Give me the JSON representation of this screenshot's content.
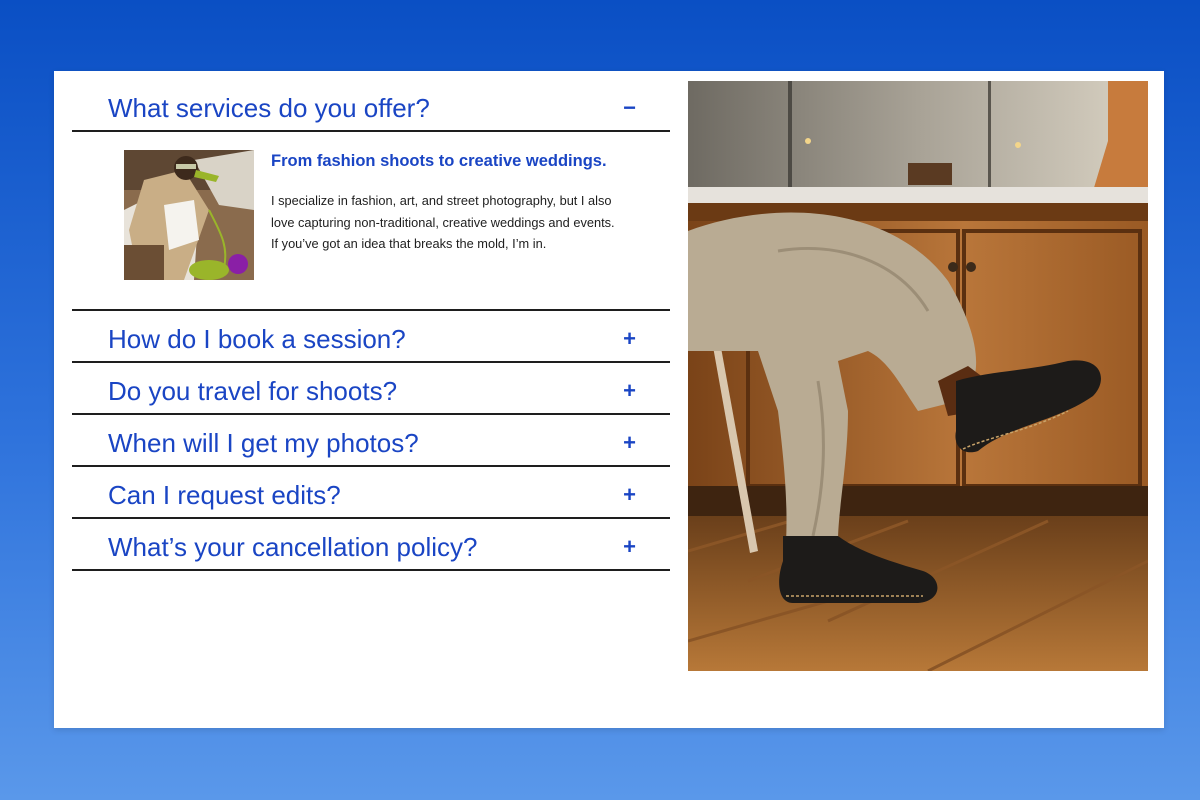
{
  "faq": {
    "items": [
      {
        "question": "What services do you offer?",
        "toggle": "−",
        "expanded": true,
        "answer_title": "From fashion shoots to creative weddings.",
        "answer_text": "I specialize in fashion, art, and street photography, but I also love capturing non-traditional, creative weddings and events. If you’ve got an idea that breaks the mold, I’m in."
      },
      {
        "question": "How do I book a session?",
        "toggle": "+",
        "expanded": false
      },
      {
        "question": "Do you travel for shoots?",
        "toggle": "+",
        "expanded": false
      },
      {
        "question": "When will I get my photos?",
        "toggle": "+",
        "expanded": false
      },
      {
        "question": "Can I request edits?",
        "toggle": "+",
        "expanded": false
      },
      {
        "question": "What’s your cancellation policy?",
        "toggle": "+",
        "expanded": false
      }
    ]
  },
  "colors": {
    "accent": "#1a45c4",
    "divider": "#1e1e1e",
    "background_top": "#0a4fc4",
    "background_bottom": "#5a98ea"
  }
}
